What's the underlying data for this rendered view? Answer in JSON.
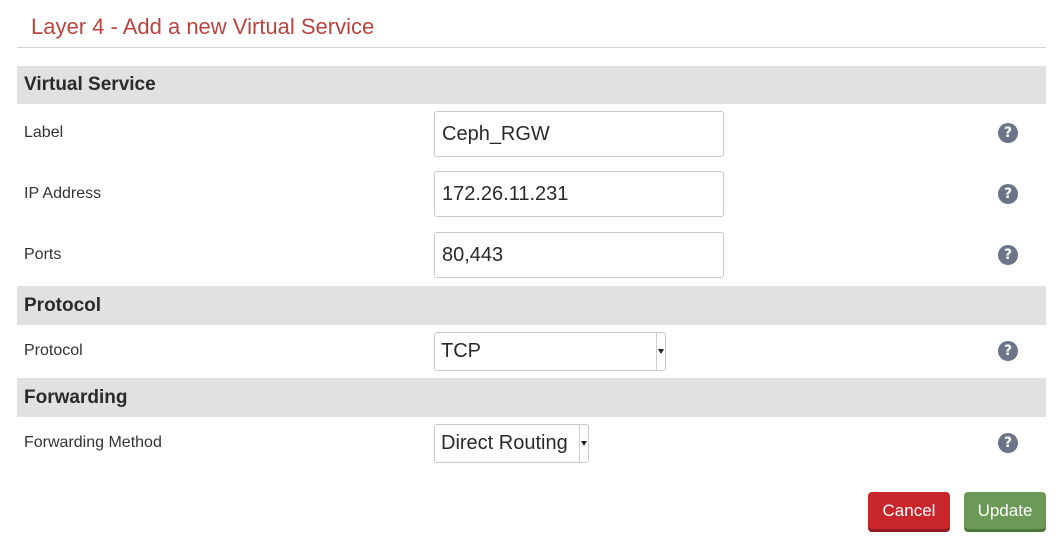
{
  "page": {
    "title": "Layer 4 - Add a new Virtual Service"
  },
  "sections": {
    "virtual_service": {
      "header": "Virtual Service",
      "label": {
        "label": "Label",
        "value": "Ceph_RGW"
      },
      "ip_address": {
        "label": "IP Address",
        "value": "172.26.11.231"
      },
      "ports": {
        "label": "Ports",
        "value": "80,443"
      }
    },
    "protocol": {
      "header": "Protocol",
      "protocol": {
        "label": "Protocol",
        "value": "TCP"
      }
    },
    "forwarding": {
      "header": "Forwarding",
      "method": {
        "label": "Forwarding Method",
        "value": "Direct Routing"
      }
    }
  },
  "help": {
    "glyph": "?"
  },
  "actions": {
    "cancel_label": "Cancel",
    "update_label": "Update"
  },
  "colors": {
    "title": "#b9443f",
    "section_bg": "#e1e1e1",
    "help_icon": "#6b7488",
    "cancel": "#c9262c",
    "update": "#6a9a55"
  }
}
